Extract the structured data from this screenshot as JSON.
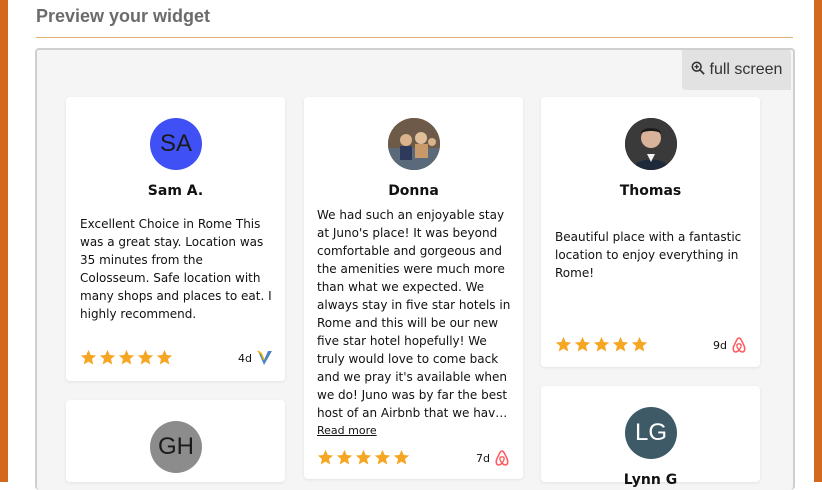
{
  "header": {
    "title": "Preview your widget"
  },
  "toolbar": {
    "fullscreen_label": "full screen",
    "fullscreen_icon": "zoom-in-icon"
  },
  "colors": {
    "star": "#f5a623",
    "airbnb": "#ff5a5f",
    "frame": "#d2691e"
  },
  "reviews": [
    {
      "initials": "SA",
      "name": "Sam A.",
      "avatar_color": "#3f51f5",
      "text": "Excellent Choice in Rome This was a great stay. Location was 35 minutes from the Colosseum. Safe location with many shops and places to eat. I highly recommend.",
      "rating": 5,
      "age": "4d",
      "source_icon": "vrbo-icon"
    },
    {
      "initials": "",
      "name": "Donna",
      "avatar_color": "#8a6f5a",
      "text": "We had such an enjoyable stay at Juno's place! It was beyond comfortable and gorgeous and the amenities were much more than what we expected. We always stay in five star hotels in Rome and this will be our new five star hotel hopefully! We truly would love to come back and we pray it's available when we do! Juno was by far the best host of an Airbnb that we hav…",
      "read_more": "Read more",
      "rating": 5,
      "age": "7d",
      "source_icon": "airbnb-icon"
    },
    {
      "initials": "",
      "name": "Thomas",
      "avatar_color": "#2b2b2b",
      "text": "Beautiful place with a fantastic location to enjoy everything in Rome!",
      "rating": 5,
      "age": "9d",
      "source_icon": "airbnb-icon"
    },
    {
      "initials": "GH",
      "name": "",
      "avatar_color": "#8c8c8c"
    },
    {
      "initials": "LG",
      "name": "Lynn G",
      "avatar_color": "#3d5a66"
    }
  ]
}
